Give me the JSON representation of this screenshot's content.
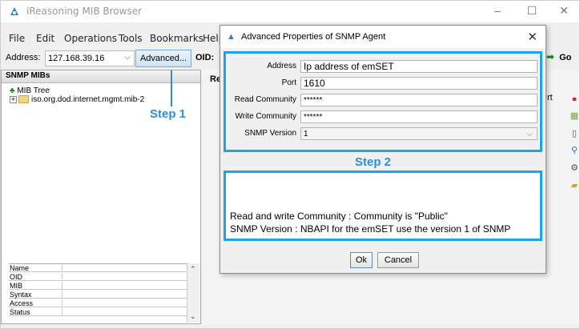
{
  "window": {
    "title": "iReasoning MIB Browser",
    "minimize_glyph": "–",
    "maximize_glyph": "☐",
    "close_glyph": "✕"
  },
  "menu": [
    "File",
    "Edit",
    "Operations",
    "Tools",
    "Bookmarks",
    "Help"
  ],
  "address_bar": {
    "label": "Address:",
    "value": "127.168.39.16",
    "advanced_button": "Advanced...",
    "oid_label": "OID:",
    "go_button": "Go"
  },
  "left_panel": {
    "header": "SNMP MIBs",
    "tree_root": "MIB Tree",
    "tree_child": "iso.org.dod.internet.mgmt.mib-2",
    "properties": [
      "Name",
      "OID",
      "MIB",
      "Syntax",
      "Access",
      "Status"
    ]
  },
  "right_panel": {
    "result_label": "Re",
    "tab_fragment": "rt"
  },
  "annotation_step1": "Step 1",
  "dialog": {
    "title": "Advanced Properties of SNMP Agent",
    "fields": [
      {
        "label": "Address",
        "value": "Ip address of emSET"
      },
      {
        "label": "Port",
        "value": "1610"
      },
      {
        "label": "Read Community",
        "value": "******"
      },
      {
        "label": "Write Community",
        "value": "******"
      }
    ],
    "snmp_version": {
      "label": "SNMP Version",
      "value": "1"
    },
    "step2": "Step 2",
    "notes": [
      "Read and write Community : Community is \"Public\"",
      "SNMP Version : NBAPI for the emSET use the version 1 of SNMP"
    ],
    "ok_button": "Ok",
    "cancel_button": "Cancel"
  },
  "colors": {
    "annotation": "#2e8fd6",
    "box_border": "#1ea3e6"
  },
  "icons": {
    "app": "snmp-browser-icon",
    "go": "green-arrow-icon",
    "side_toolbar": [
      "stop-icon",
      "table-icon",
      "page-icon",
      "search-icon",
      "tools-icon",
      "folder-open-icon"
    ]
  }
}
